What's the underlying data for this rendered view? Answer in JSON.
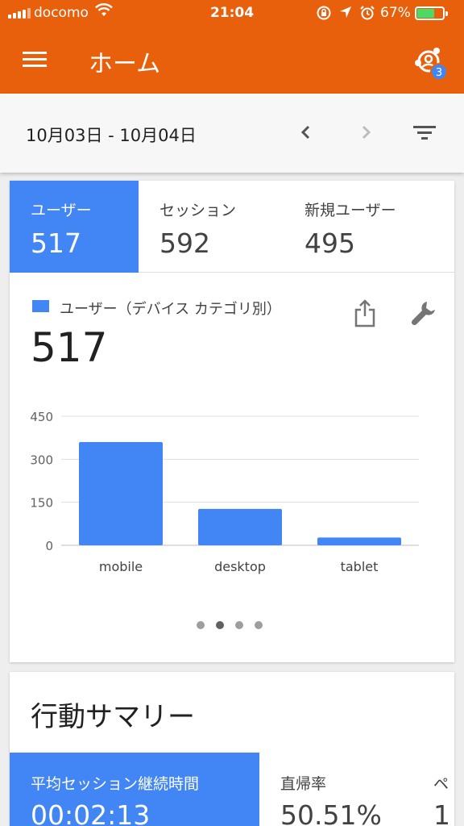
{
  "status_bar": {
    "carrier": "docomo",
    "time": "21:04",
    "battery_percent": "67%",
    "battery_level": 0.67,
    "battery_color": "#4cd964",
    "icons": [
      "signal-icon",
      "wifi-icon",
      "rotation-lock-icon",
      "location-icon",
      "alarm-icon",
      "battery-icon"
    ]
  },
  "app_bar": {
    "title": "ホーム",
    "background": "#e8600c",
    "account_badge": "3",
    "icons": [
      "menu-icon",
      "account-switcher-icon"
    ]
  },
  "date_bar": {
    "range": "10月03日 - 10月04日",
    "icons": [
      "chevron-left-icon",
      "chevron-right-icon",
      "filter-icon"
    ]
  },
  "metrics": {
    "tabs": [
      {
        "label": "ユーザー",
        "value": "517",
        "active": true
      },
      {
        "label": "セッション",
        "value": "592",
        "active": false
      },
      {
        "label": "新規ユーザー",
        "value": "495",
        "active": false
      }
    ]
  },
  "device_card": {
    "legend": "ユーザー（デバイス カテゴリ別）",
    "total": "517",
    "accent": "#4285f4",
    "icons": [
      "share-icon",
      "wrench-icon"
    ],
    "pager": {
      "count": 4,
      "active_index": 1
    }
  },
  "chart_data": {
    "type": "bar",
    "categories": [
      "mobile",
      "desktop",
      "tablet"
    ],
    "values": [
      360,
      127,
      27
    ],
    "ylim": [
      0,
      450
    ],
    "yticks": [
      "450",
      "300",
      "150",
      "0"
    ],
    "grid": true,
    "color": "#4285f4"
  },
  "summary": {
    "title": "行動サマリー",
    "tabs": [
      {
        "label": "平均セッション継続時間",
        "value": "00:02:13",
        "active": true
      },
      {
        "label": "直帰率",
        "value": "50.51%",
        "active": false
      },
      {
        "label": "ペ",
        "value": "1",
        "active": false
      }
    ]
  }
}
